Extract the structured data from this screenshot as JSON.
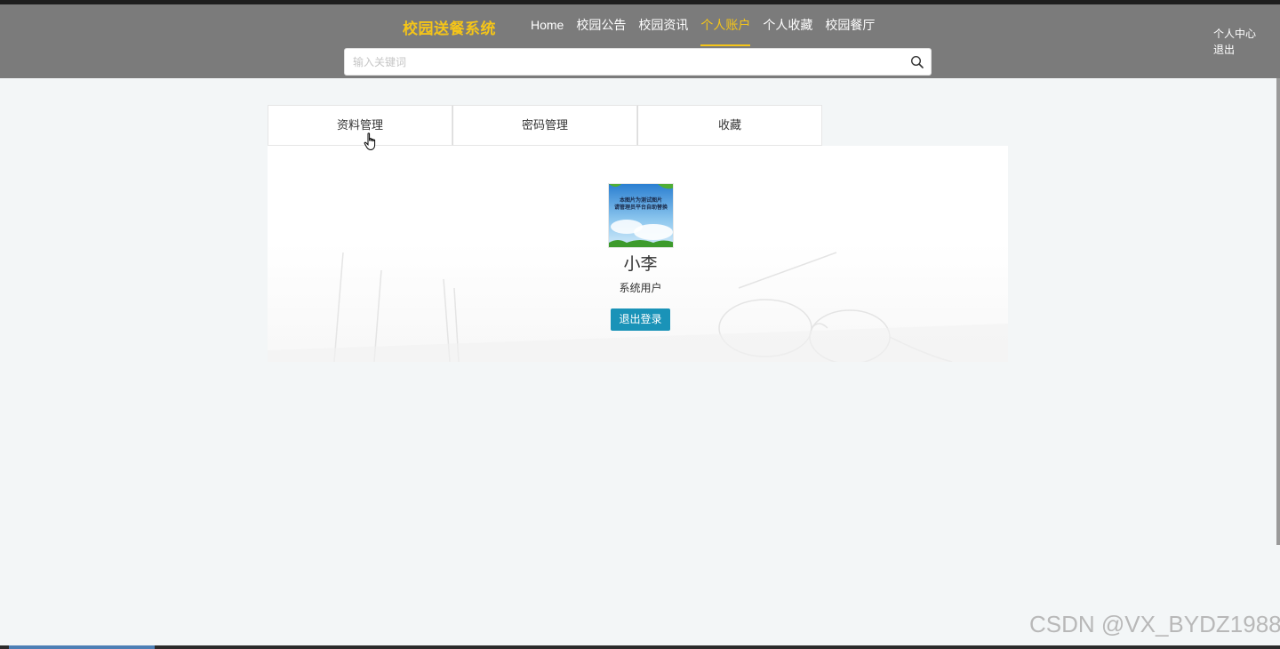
{
  "header": {
    "logo": "校园送餐系统",
    "nav": [
      "Home",
      "校园公告",
      "校园资讯",
      "个人账户",
      "个人收藏",
      "校园餐厅"
    ],
    "active_nav": "个人账户",
    "user_links": [
      "个人中心",
      "退出"
    ],
    "accent_color": "#f5c518"
  },
  "search": {
    "placeholder": "输入关键词",
    "value": ""
  },
  "tabs": [
    "资料管理",
    "密码管理",
    "收藏"
  ],
  "profile": {
    "avatar_text_line1": "本图片为测试图片",
    "avatar_text_line2": "请管理员平台自助替换",
    "username": "小李",
    "role": "系统用户",
    "logout_label": "退出登录",
    "button_color": "#1a93b8"
  },
  "watermark": "CSDN @VX_BYDZ1988"
}
